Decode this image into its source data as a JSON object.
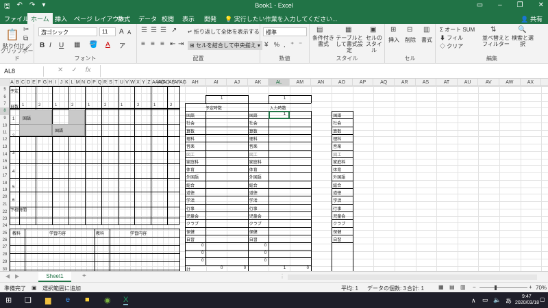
{
  "titlebar": {
    "title": "Book1 - Excel",
    "save_icon": "save-icon",
    "undo_icon": "undo-icon",
    "redo_icon": "redo-icon"
  },
  "tabs": [
    "ファイル",
    "ホーム",
    "挿入",
    "ページ レイアウト",
    "数式",
    "データ",
    "校閲",
    "表示",
    "開発"
  ],
  "tellme": "実行したい作業を入力してください...",
  "share": "共有",
  "ribbon": {
    "clipboard": {
      "paste": "貼り付け",
      "label": "クリップボード"
    },
    "font": {
      "name": "游ゴシック",
      "size": "11",
      "label": "フォント",
      "bold": "B",
      "italic": "I",
      "underline": "U",
      "size_up": "A",
      "size_down": "A",
      "font_color": "A",
      "phonetic": "ア"
    },
    "align": {
      "wrap": "折り返して全体を表示する",
      "merge": "セルを結合して中央揃え",
      "label": "配置"
    },
    "number": {
      "format": "標準",
      "percent": "%",
      "comma": ",",
      "label": "数値"
    },
    "styles": {
      "cond": "条件付き書式",
      "table": "テーブルとして書式設定",
      "cell": "セルのスタイル",
      "label": "スタイル"
    },
    "cells": {
      "insert": "挿入",
      "delete": "削除",
      "format": "書式",
      "label": "セル"
    },
    "editing": {
      "autosum": "オート SUM",
      "fill": "フィル",
      "clear": "クリア",
      "sort": "並べ替えとフィルター",
      "find": "検索と選択",
      "label": "編集"
    }
  },
  "formula": {
    "namebox": "AL8",
    "fx": "fx",
    "cancel": "✕",
    "enter": "✓"
  },
  "columns": [
    "A",
    "B",
    "C",
    "D",
    "E",
    "F",
    "G",
    "H",
    "I",
    "J",
    "K",
    "L",
    "M",
    "N",
    "O",
    "P",
    "Q",
    "R",
    "S",
    "T",
    "U",
    "V",
    "W",
    "X",
    "Y",
    "Z",
    "AAAB",
    "AC",
    "AD",
    "AE",
    "AF",
    "AG",
    "AH",
    "AI",
    "AJ",
    "AK",
    "AL",
    "AM",
    "AN",
    "AO",
    "AP",
    "AQ",
    "AR",
    "AS",
    "AT",
    "AU",
    "AV",
    "AW",
    "AX",
    "AY"
  ],
  "rows": [
    "5",
    "6",
    "7",
    "8",
    "9",
    "10",
    "11",
    "12",
    "13",
    "14",
    "15",
    "16",
    "17",
    "18",
    "19",
    "20",
    "21",
    "22",
    "23",
    "24",
    "25",
    "26",
    "27",
    "28",
    "29",
    "30",
    "31"
  ],
  "left_sheet": {
    "yotei": "予定",
    "nissu": "日数",
    "header_nums": [
      "1",
      "2",
      "1",
      "2",
      "1",
      "2",
      "1",
      "2",
      "1",
      "2"
    ],
    "row_nums": [
      "1",
      "2",
      "3",
      "4",
      "5",
      "6"
    ],
    "houka": "下校時間",
    "kokugo": "国語",
    "footer": [
      "教科",
      "学習内容",
      "教科",
      "学習内容"
    ]
  },
  "table1": {
    "top": "1",
    "title": "予定時数",
    "subjects": [
      "国語",
      "社会",
      "算数",
      "理科",
      "音楽",
      "図工",
      "家庭科",
      "体育",
      "外国語",
      "総合",
      "道徳",
      "学活",
      "行事",
      "児童会",
      "クラブ",
      "保健",
      "自習"
    ],
    "zeros": [
      "0",
      "0",
      "0"
    ],
    "total": "計",
    "total_vals": [
      "0",
      "0"
    ]
  },
  "table2": {
    "top": "1",
    "title": "入力時数",
    "val": "1",
    "subjects": [
      "国語",
      "社会",
      "算数",
      "理科",
      "音楽",
      "図工",
      "家庭科",
      "体育",
      "外国語",
      "総合",
      "道徳",
      "学活",
      "行事",
      "児童会",
      "クラブ",
      "保健",
      "自習"
    ],
    "zeros": [
      "0",
      "0",
      "0"
    ],
    "total_vals": [
      "1",
      "0"
    ]
  },
  "table3": {
    "subjects": [
      "国語",
      "社会",
      "算数",
      "理科",
      "音楽",
      "図工",
      "家庭科",
      "体育",
      "外国語",
      "総合",
      "道徳",
      "学活",
      "行事",
      "児童会",
      "クラブ",
      "保健",
      "自習"
    ]
  },
  "sheet": {
    "name": "Sheet1",
    "add": "+"
  },
  "status": {
    "ready": "準備完了",
    "mode": "選択範囲に追加",
    "avg": "平均: 1",
    "count": "データの個数: 3",
    "sum": "合計: 1",
    "zoom": "70%"
  },
  "taskbar": {
    "time": "9:47",
    "date": "2020/03/18",
    "ime": "あ"
  }
}
